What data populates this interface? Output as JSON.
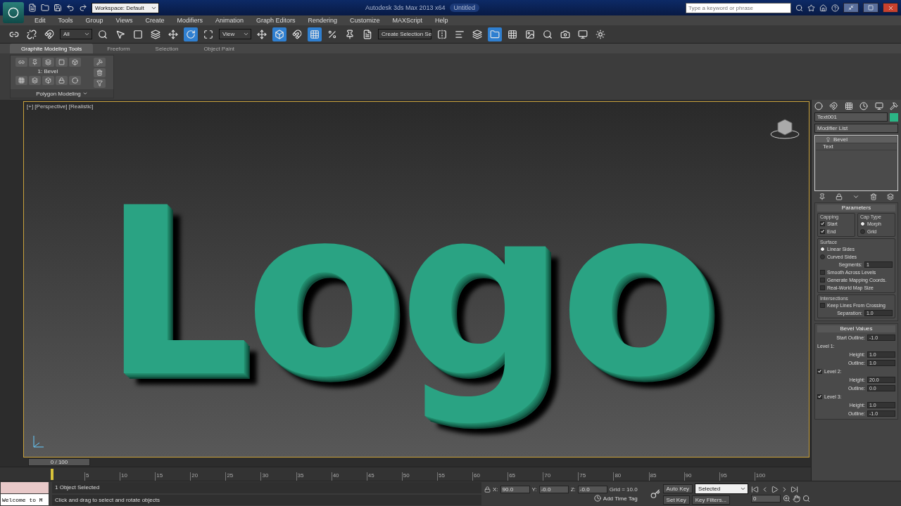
{
  "title_bar": {
    "workspace": "Workspace: Default",
    "title": "Autodesk 3ds Max 2013 x64",
    "document": "Untitled",
    "search": {
      "placeholder": "Type a keyword or phrase"
    }
  },
  "menu": [
    "Edit",
    "Tools",
    "Group",
    "Views",
    "Create",
    "Modifiers",
    "Animation",
    "Graph Editors",
    "Rendering",
    "Customize",
    "MAXScript",
    "Help"
  ],
  "main_toolbar": {
    "selection_filter": "All",
    "reference_coord": "View",
    "named_selection": "Create Selection Se"
  },
  "ribbon": {
    "tabs": [
      {
        "label": "Graphite Modeling Tools",
        "selected": true
      },
      {
        "label": "Freeform",
        "selected": false
      },
      {
        "label": "Selection",
        "selected": false
      },
      {
        "label": "Object Paint",
        "selected": false
      }
    ],
    "level_label": "1: Bevel",
    "panel_title": "Polygon Modeling"
  },
  "viewport": {
    "label": "[+] [Perspective] [Realistic]",
    "scene_text": "Logo"
  },
  "command_panel": {
    "object_name": "Text001",
    "modifier_list": "Modifier List",
    "stack": [
      {
        "label": "Bevel",
        "selected": true
      },
      {
        "label": "Text",
        "selected": false
      }
    ],
    "parameters": {
      "title": "Parameters",
      "capping": {
        "title": "Capping",
        "items": [
          {
            "label": "Start",
            "checked": true
          },
          {
            "label": "End",
            "checked": true
          }
        ]
      },
      "cap_type": {
        "title": "Cap Type",
        "items": [
          {
            "label": "Morph",
            "selected": true
          },
          {
            "label": "Grid",
            "selected": false
          }
        ]
      },
      "surface": {
        "title": "Surface",
        "items": [
          {
            "kind": "radio",
            "label": "Linear Sides",
            "selected": true
          },
          {
            "kind": "radio",
            "label": "Curved Sides",
            "selected": false
          },
          {
            "kind": "spinner",
            "label": "Segments:",
            "value": "1"
          },
          {
            "kind": "checkbox",
            "label": "Smooth Across Levels",
            "checked": false
          },
          {
            "kind": "checkbox",
            "label": "Generate Mapping Coords.",
            "checked": false
          },
          {
            "kind": "checkbox",
            "label": "Real-World Map Size",
            "checked": false
          }
        ]
      },
      "intersections": {
        "title": "Intersections",
        "items": [
          {
            "kind": "checkbox",
            "label": "Keep Lines From Crossing",
            "checked": false
          },
          {
            "kind": "spinner",
            "label": "Separation:",
            "value": "1.0"
          }
        ]
      }
    },
    "bevel_values": {
      "title": "Bevel Values",
      "items": [
        {
          "kind": "spinner",
          "label": "Start Outline:",
          "value": "-1.0"
        },
        {
          "kind": "label",
          "label": "Level 1:"
        },
        {
          "kind": "spinner",
          "label": "Height:",
          "value": "1.0"
        },
        {
          "kind": "spinner",
          "label": "Outline:",
          "value": "1.0"
        },
        {
          "kind": "checkbox",
          "label": "Level 2:",
          "checked": true
        },
        {
          "kind": "spinner",
          "label": "Height:",
          "value": "20.0"
        },
        {
          "kind": "spinner",
          "label": "Outline:",
          "value": "0.0"
        },
        {
          "kind": "checkbox",
          "label": "Level 3:",
          "checked": true
        },
        {
          "kind": "spinner",
          "label": "Height:",
          "value": "1.0"
        },
        {
          "kind": "spinner",
          "label": "Outline:",
          "value": "-1.0"
        }
      ]
    }
  },
  "timeline": {
    "frame_counter": "0 / 100",
    "ticks": [
      "5",
      "10",
      "15",
      "20",
      "25",
      "30",
      "35",
      "40",
      "45",
      "50",
      "55",
      "60",
      "65",
      "70",
      "75",
      "80",
      "85",
      "90",
      "95",
      "100"
    ]
  },
  "status_bar": {
    "listener": "Welcome to M",
    "selection_info": "1 Object Selected",
    "prompt": "Click and drag to select and rotate objects",
    "coords": [
      {
        "label": "X:",
        "value": "90.0"
      },
      {
        "label": "Y:",
        "value": "-0.0"
      },
      {
        "label": "Z:",
        "value": "-0.0"
      }
    ],
    "grid": "Grid = 10.0",
    "time_tag": "Add Time Tag",
    "auto_key": "Auto Key",
    "key_mode": "Selected",
    "set_key": "Set Key",
    "key_filters": "Key Filters...",
    "frame": "0"
  }
}
